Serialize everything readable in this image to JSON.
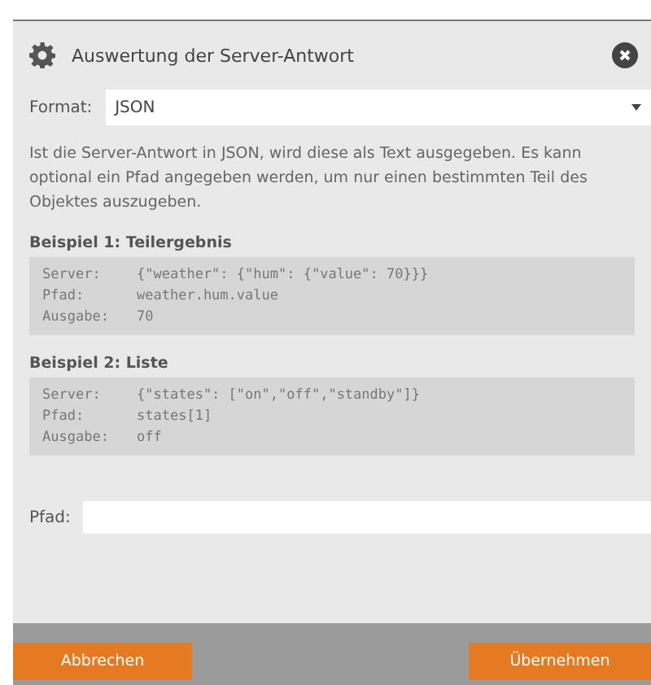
{
  "dialog": {
    "title": "Auswertung der Server-Antwort"
  },
  "format": {
    "label": "Format:",
    "value": "JSON"
  },
  "description": "Ist die Server-Antwort in JSON, wird diese als Text ausgegeben. Es kann optional ein Pfad angegeben werden, um nur einen bestimmten Teil des Objektes auszugeben.",
  "examples": [
    {
      "title": "Beispiel 1: Teilergebnis",
      "rows": [
        {
          "label": "Server:",
          "value": "{\"weather\": {\"hum\": {\"value\": 70}}}"
        },
        {
          "label": "Pfad:",
          "value": "weather.hum.value"
        },
        {
          "label": "Ausgabe:",
          "value": "70"
        }
      ]
    },
    {
      "title": "Beispiel 2: Liste",
      "rows": [
        {
          "label": "Server:",
          "value": "{\"states\": [\"on\",\"off\",\"standby\"]}"
        },
        {
          "label": "Pfad:",
          "value": "states[1]"
        },
        {
          "label": "Ausgabe:",
          "value": "off"
        }
      ]
    }
  ],
  "path": {
    "label": "Pfad:"
  },
  "buttons": {
    "cancel": "Abbrechen",
    "apply": "Übernehmen"
  }
}
